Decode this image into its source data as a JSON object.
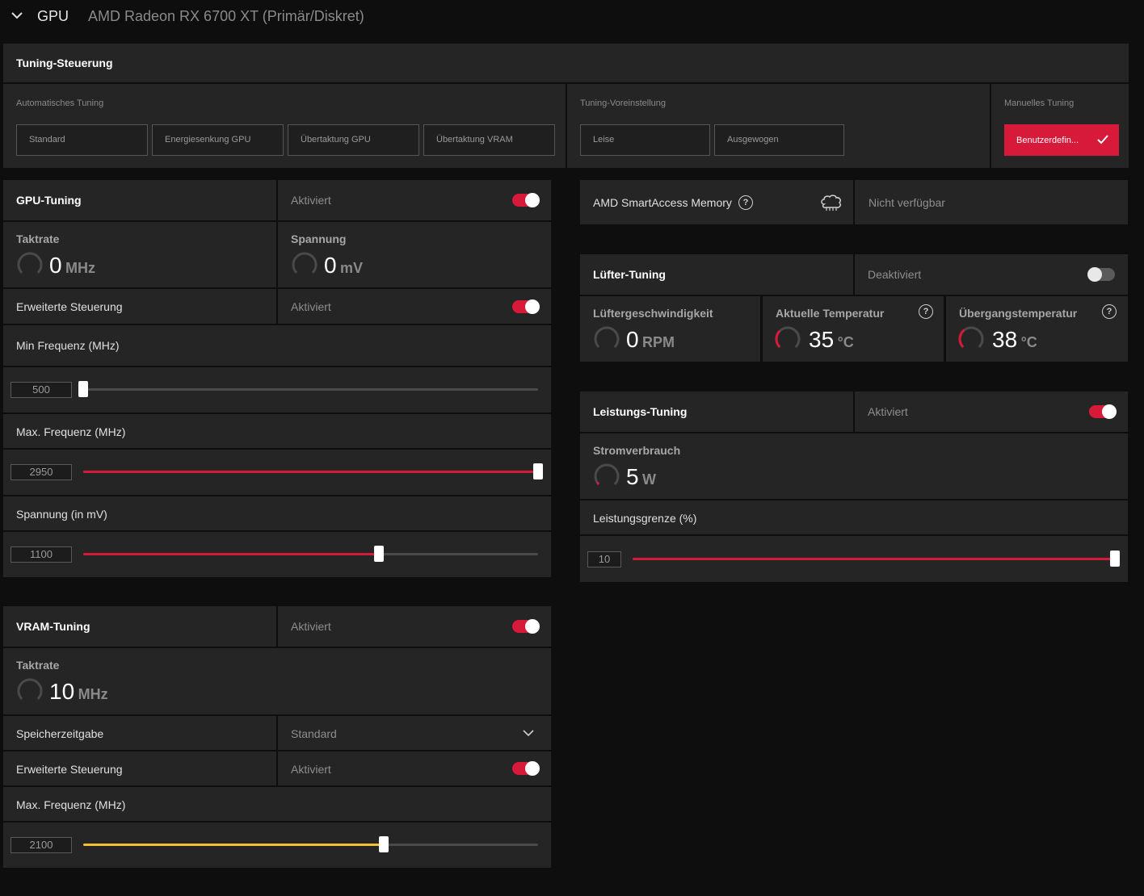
{
  "header": {
    "section": "GPU",
    "device": "AMD Radeon RX 6700 XT (Primär/Diskret)"
  },
  "colors": {
    "accent": "#d7193a",
    "vram_accent": "#f2c12e",
    "panel": "#252525",
    "background": "#0e0e0e"
  },
  "tuning_control": {
    "title": "Tuning-Steuerung",
    "auto_label": "Automatisches Tuning",
    "auto_buttons": [
      "Standard",
      "Energiesenkung GPU",
      "Übertaktung GPU",
      "Übertaktung VRAM"
    ],
    "preset_label": "Tuning-Voreinstellung",
    "preset_buttons": [
      "Leise",
      "Ausgewogen"
    ],
    "manual_label": "Manuelles Tuning",
    "manual_button": "Benutzerdefin..."
  },
  "gpu_tuning": {
    "title": "GPU-Tuning",
    "status": "Aktiviert",
    "enabled": true,
    "clock": {
      "label": "Taktrate",
      "value": "0",
      "unit": "MHz"
    },
    "voltage": {
      "label": "Spannung",
      "value": "0",
      "unit": "mV"
    },
    "advanced": {
      "label": "Erweiterte Steuerung",
      "status": "Aktiviert",
      "enabled": true
    },
    "min_freq": {
      "label": "Min Frequenz (MHz)",
      "value": "500",
      "level": 0.0
    },
    "max_freq": {
      "label": "Max. Frequenz (MHz)",
      "value": "2950",
      "level": 1.0
    },
    "voltage_slider": {
      "label": "Spannung (in mV)",
      "value": "1100",
      "level": 0.65
    }
  },
  "vram_tuning": {
    "title": "VRAM-Tuning",
    "status": "Aktiviert",
    "enabled": true,
    "clock": {
      "label": "Taktrate",
      "value": "10",
      "unit": "MHz"
    },
    "timing": {
      "label": "Speicherzeitgabe",
      "value": "Standard"
    },
    "advanced": {
      "label": "Erweiterte Steuerung",
      "status": "Aktiviert",
      "enabled": true
    },
    "max_freq": {
      "label": "Max. Frequenz (MHz)",
      "value": "2100",
      "level": 0.66
    }
  },
  "smart_access": {
    "label": "AMD SmartAccess Memory",
    "status": "Nicht verfügbar"
  },
  "fan_tuning": {
    "title": "Lüfter-Tuning",
    "status": "Deaktiviert",
    "enabled": false,
    "fan_speed": {
      "label": "Lüftergeschwindigkeit",
      "value": "0",
      "unit": "RPM"
    },
    "temp": {
      "label": "Aktuelle Temperatur",
      "value": "35",
      "unit": "°C"
    },
    "junction": {
      "label": "Übergangstemperatur",
      "value": "38",
      "unit": "°C"
    }
  },
  "power_tuning": {
    "title": "Leistungs-Tuning",
    "status": "Aktiviert",
    "enabled": true,
    "power": {
      "label": "Stromverbrauch",
      "value": "5",
      "unit": "W"
    },
    "limit": {
      "label": "Leistungsgrenze (%)",
      "value": "10",
      "level": 1.0
    }
  }
}
